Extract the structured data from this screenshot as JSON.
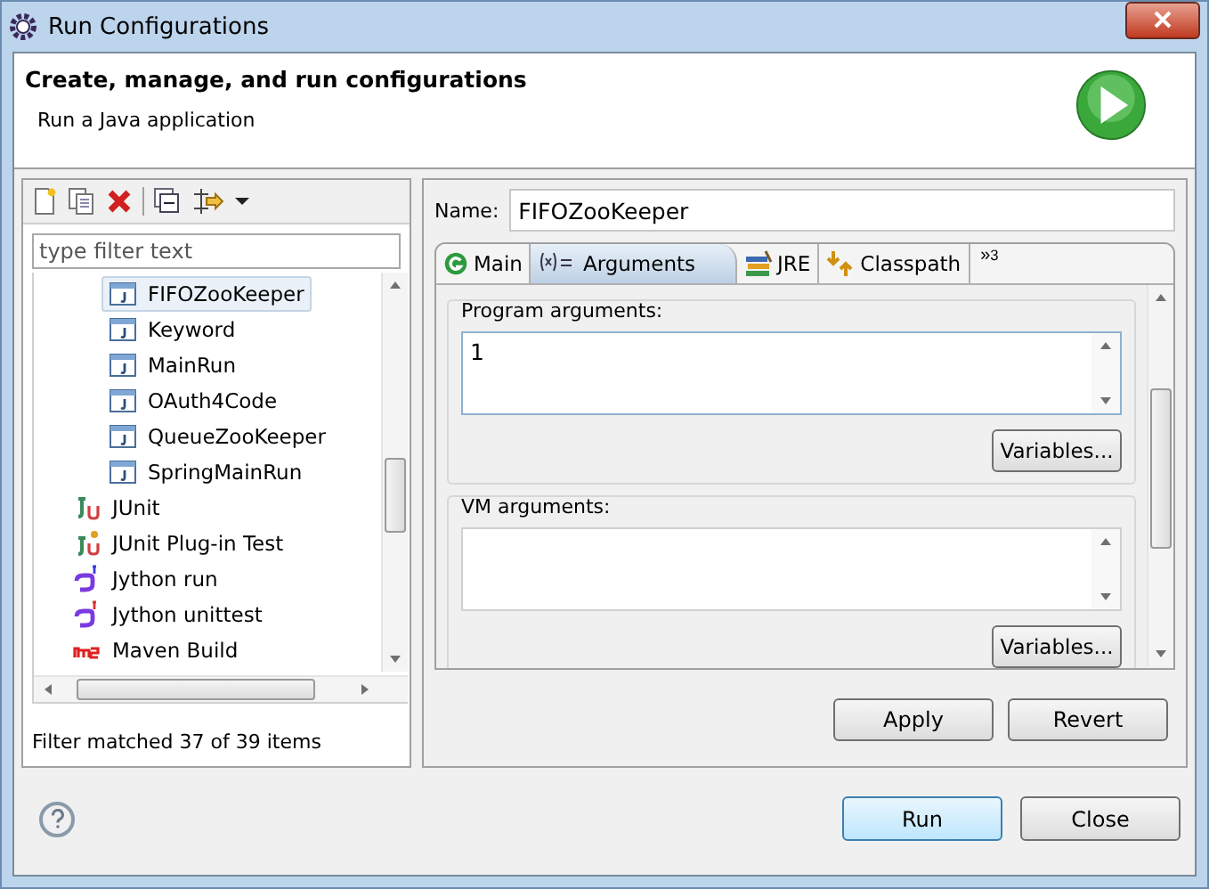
{
  "window": {
    "title": "Run Configurations"
  },
  "header": {
    "title": "Create, manage, and run configurations",
    "subtitle": "Run a Java application"
  },
  "filter": {
    "placeholder": "type filter text"
  },
  "tree": {
    "configurations": [
      {
        "label": "FIFOZooKeeper",
        "selected": true
      },
      {
        "label": "Keyword",
        "selected": false
      },
      {
        "label": "MainRun",
        "selected": false
      },
      {
        "label": "OAuth4Code",
        "selected": false
      },
      {
        "label": "QueueZooKeeper",
        "selected": false
      },
      {
        "label": "SpringMainRun",
        "selected": false
      }
    ],
    "types": [
      {
        "label": "JUnit",
        "kind": "junit",
        "selected": false
      },
      {
        "label": "JUnit Plug-in Test",
        "kind": "junitplugin",
        "selected": false
      },
      {
        "label": "Jython run",
        "kind": "jython",
        "selected": false
      },
      {
        "label": "Jython unittest",
        "kind": "jythonunit",
        "selected": false
      },
      {
        "label": "Maven Build",
        "kind": "maven",
        "selected": false
      }
    ]
  },
  "status": "Filter matched 37 of 39 items",
  "name": {
    "label": "Name:",
    "value": "FIFOZooKeeper"
  },
  "tabs": [
    {
      "label": "Main",
      "kind": "main",
      "selected": false
    },
    {
      "label": "Arguments",
      "kind": "args",
      "selected": true
    },
    {
      "label": "JRE",
      "kind": "jre",
      "selected": false
    },
    {
      "label": "Classpath",
      "kind": "classpath",
      "selected": false
    }
  ],
  "more_tabs": {
    "label": "»",
    "count": "3"
  },
  "groups": [
    {
      "label": "Program arguments:",
      "value": "1",
      "button": "Variables..."
    },
    {
      "label": "VM arguments:",
      "button": "Variables..."
    }
  ],
  "actions": [
    "Apply",
    "Revert"
  ],
  "buttons": [
    {
      "label": "Run",
      "selected": true
    },
    {
      "label": "Close",
      "selected": false
    }
  ]
}
